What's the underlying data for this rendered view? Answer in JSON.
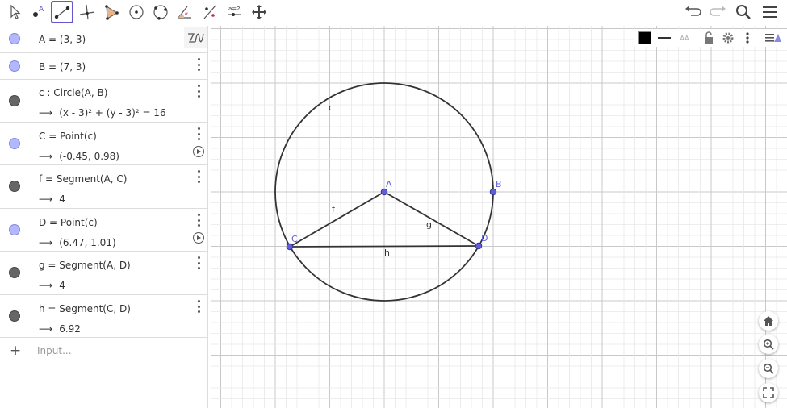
{
  "toolbar": {
    "tools": [
      "move-tool",
      "point-tool",
      "segment-tool",
      "perpendicular-line-tool",
      "polygon-tool",
      "circle-center-point-tool",
      "circle-three-points-tool",
      "angle-tool",
      "reflect-tool",
      "slider-tool",
      "move-graphics-view-tool"
    ],
    "active_tool": "segment-tool",
    "slider_label": "a=2"
  },
  "algebra": {
    "rows": [
      {
        "def": "A = (3, 3)",
        "value": "",
        "marker": "blue"
      },
      {
        "def": "B = (7, 3)",
        "value": "",
        "marker": "blue"
      },
      {
        "def": "c : Circle(A, B)",
        "value": "(x - 3)² + (y - 3)² = 16",
        "marker": "dark"
      },
      {
        "def": "C = Point(c)",
        "value": "(-0.45, 0.98)",
        "marker": "blue"
      },
      {
        "def": "f = Segment(A, C)",
        "value": "4",
        "marker": "dark"
      },
      {
        "def": "D = Point(c)",
        "value": "(6.47, 1.01)",
        "marker": "blue"
      },
      {
        "def": "g = Segment(A, D)",
        "value": "4",
        "marker": "dark"
      },
      {
        "def": "h = Segment(C, D)",
        "value": "6.92",
        "marker": "dark"
      }
    ],
    "arrow": "⟶",
    "input_placeholder": "Input...",
    "add_symbol": "+"
  },
  "style_bar": {
    "font_size_label": "AA",
    "colors": {
      "fill": "#000000"
    }
  },
  "graphics": {
    "labels": {
      "A": "A",
      "B": "B",
      "C": "C",
      "D": "D",
      "c": "c",
      "f": "f",
      "g": "g",
      "h": "h"
    },
    "colors": {
      "point": "#5e5eda",
      "label": "#5e5eda",
      "line": "#333333",
      "grid_major": "#c8c8c8",
      "grid_minor": "#e8e8e8"
    }
  }
}
